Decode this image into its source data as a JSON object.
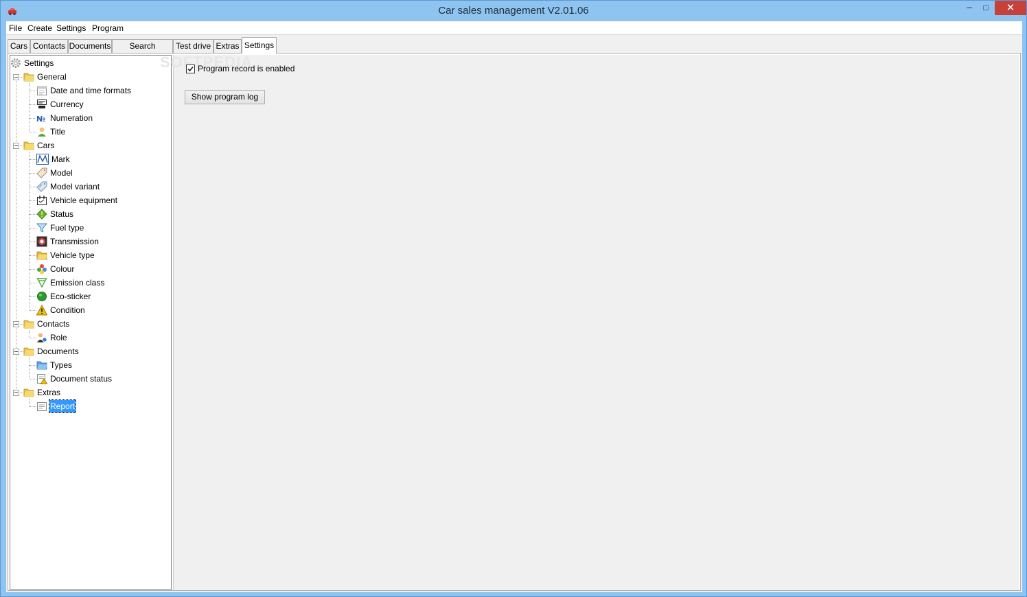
{
  "window": {
    "title": "Car sales management V2.01.06",
    "controls": {
      "minimize": "–",
      "maximize": "□",
      "close": "✕"
    }
  },
  "menubar": {
    "items": [
      "File",
      "Create",
      "Settings",
      "Program"
    ]
  },
  "tabs": [
    {
      "label": "Cars",
      "active": false
    },
    {
      "label": "Contacts",
      "active": false
    },
    {
      "label": "Documents",
      "active": false
    },
    {
      "label": "Search requests",
      "active": false
    },
    {
      "label": "Test drive",
      "active": false
    },
    {
      "label": "Extras",
      "active": false
    },
    {
      "label": "Settings",
      "active": true
    }
  ],
  "tree": {
    "root": {
      "label": "Settings",
      "icon": "gear-icon"
    },
    "groups": [
      {
        "label": "General",
        "icon": "folder-icon",
        "items": [
          {
            "label": "Date and time formats",
            "icon": "calendar-icon"
          },
          {
            "label": "Currency",
            "icon": "cash-register-icon"
          },
          {
            "label": "Numeration",
            "icon": "numero-icon"
          },
          {
            "label": "Title",
            "icon": "person-icon"
          }
        ]
      },
      {
        "label": "Cars",
        "icon": "folder-icon",
        "items": [
          {
            "label": "Mark",
            "icon": "brand-logo-icon"
          },
          {
            "label": "Model",
            "icon": "tag-icon"
          },
          {
            "label": "Model variant",
            "icon": "tags-icon"
          },
          {
            "label": "Vehicle equipment",
            "icon": "equipment-icon"
          },
          {
            "label": "Status",
            "icon": "status-diamond-icon"
          },
          {
            "label": "Fuel type",
            "icon": "funnel-icon"
          },
          {
            "label": "Transmission",
            "icon": "gearbox-icon"
          },
          {
            "label": "Vehicle type",
            "icon": "folder-open-icon"
          },
          {
            "label": "Colour",
            "icon": "palette-icon"
          },
          {
            "label": "Emission class",
            "icon": "emission-icon"
          },
          {
            "label": "Eco-sticker",
            "icon": "green-dot-icon"
          },
          {
            "label": "Condition",
            "icon": "warning-icon"
          }
        ]
      },
      {
        "label": "Contacts",
        "icon": "folder-icon",
        "items": [
          {
            "label": "Role",
            "icon": "user-role-icon"
          }
        ]
      },
      {
        "label": "Documents",
        "icon": "folder-icon",
        "items": [
          {
            "label": "Types",
            "icon": "folder-blue-icon"
          },
          {
            "label": "Document status",
            "icon": "document-status-icon"
          }
        ]
      },
      {
        "label": "Extras",
        "icon": "folder-icon",
        "items": [
          {
            "label": "Report",
            "icon": "report-icon",
            "selected": true
          }
        ]
      }
    ]
  },
  "settings_panel": {
    "program_record_label": "Program record is enabled",
    "program_record_checked": true,
    "show_log_button": "Show program log"
  },
  "watermark": "SOFTPEDIA"
}
